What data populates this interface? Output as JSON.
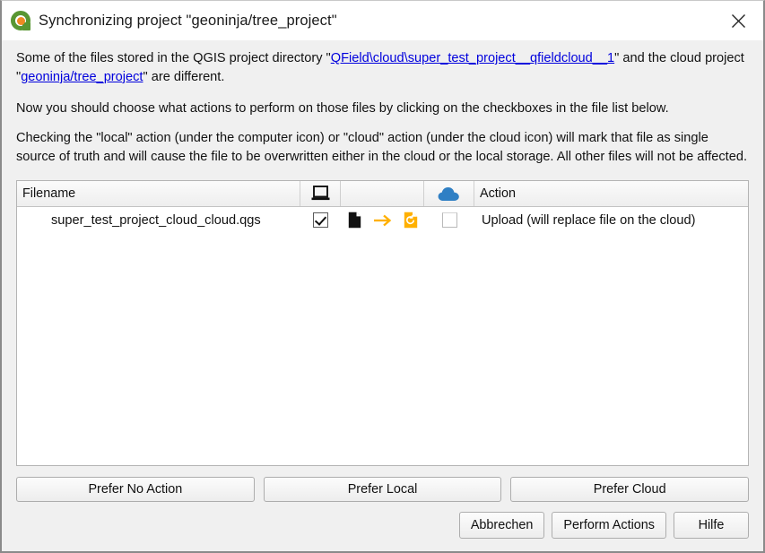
{
  "window": {
    "title": "Synchronizing project \"geoninja/tree_project\"",
    "logo_icon": "qgis-logo",
    "close_icon": "close-icon"
  },
  "description": {
    "para1_before": "Some of the files stored in the QGIS project directory \"",
    "para1_link": "QField\\cloud\\super_test_project__qfieldcloud__1",
    "para1_middle": "\" and the cloud project \"",
    "para1_link2": "geoninja/tree_project",
    "para1_after": "\" are different.",
    "para2": "Now you should choose what actions to perform on those files by clicking on the checkboxes in the file list below.",
    "para3": "Checking the \"local\" action (under the computer icon) or \"cloud\" action (under the cloud icon) will mark that file as single source of truth and will cause the file to be overwritten either in the cloud or the local storage. All other files will not be affected."
  },
  "table": {
    "columns": [
      {
        "label": "Filename",
        "icon": null
      },
      {
        "label": "",
        "icon": "computer-icon"
      },
      {
        "label": "",
        "icon": null
      },
      {
        "label": "",
        "icon": "cloud-icon"
      },
      {
        "label": "Action",
        "icon": null
      }
    ],
    "rows": [
      {
        "filename": "super_test_project_cloud_cloud.qgs",
        "local_checked": true,
        "cloud_checked": false,
        "mid_icons": [
          "document-icon",
          "arrow-right-icon",
          "document-refresh-icon"
        ],
        "action": "Upload (will replace file on the cloud)"
      }
    ]
  },
  "footer": {
    "prefer_no_action": "Prefer No Action",
    "prefer_local": "Prefer Local",
    "prefer_cloud": "Prefer Cloud",
    "cancel": "Abbrechen",
    "perform_actions": "Perform Actions",
    "help": "Hilfe"
  },
  "colors": {
    "link": "#0000dd",
    "cloud": "#2f7fc4",
    "accent_orange": "#ffb000",
    "qgis_green": "#589632",
    "qgis_orange": "#ef8a22"
  }
}
